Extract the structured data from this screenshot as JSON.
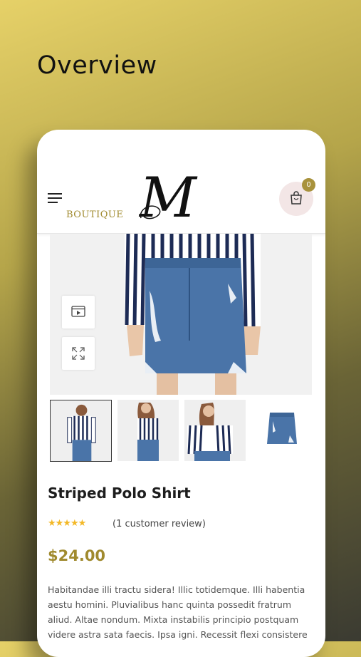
{
  "page": {
    "headline": "Overview"
  },
  "header": {
    "logo_letter": "M",
    "logo_text": "BOUTIQUE",
    "cart_count": "0"
  },
  "product": {
    "title": "Striped Polo Shirt",
    "rating": 5,
    "stars": "★★★★★",
    "review_text": "(1 customer review)",
    "price": "$24.00",
    "description": "Habitandae illi tractu sidera! Illic totidemque. Illi habentia aestu homini. Pluvialibus hanc quinta possedit fratrum aliud. Altae nondum. Mixta instabilis principio postquam videre astra sata faecis. Ipsa igni. Recessit flexi consistere"
  },
  "media": {
    "buttons": [
      "video-icon",
      "expand-icon"
    ],
    "thumbnails": [
      "thumb-front",
      "thumb-side",
      "thumb-closeup",
      "thumb-skirt"
    ]
  },
  "colors": {
    "accent": "#a08a2e",
    "badge": "#a8923c",
    "star": "#f3b826",
    "cart_bg": "#f3e6e6",
    "denim": "#4a74a8"
  }
}
